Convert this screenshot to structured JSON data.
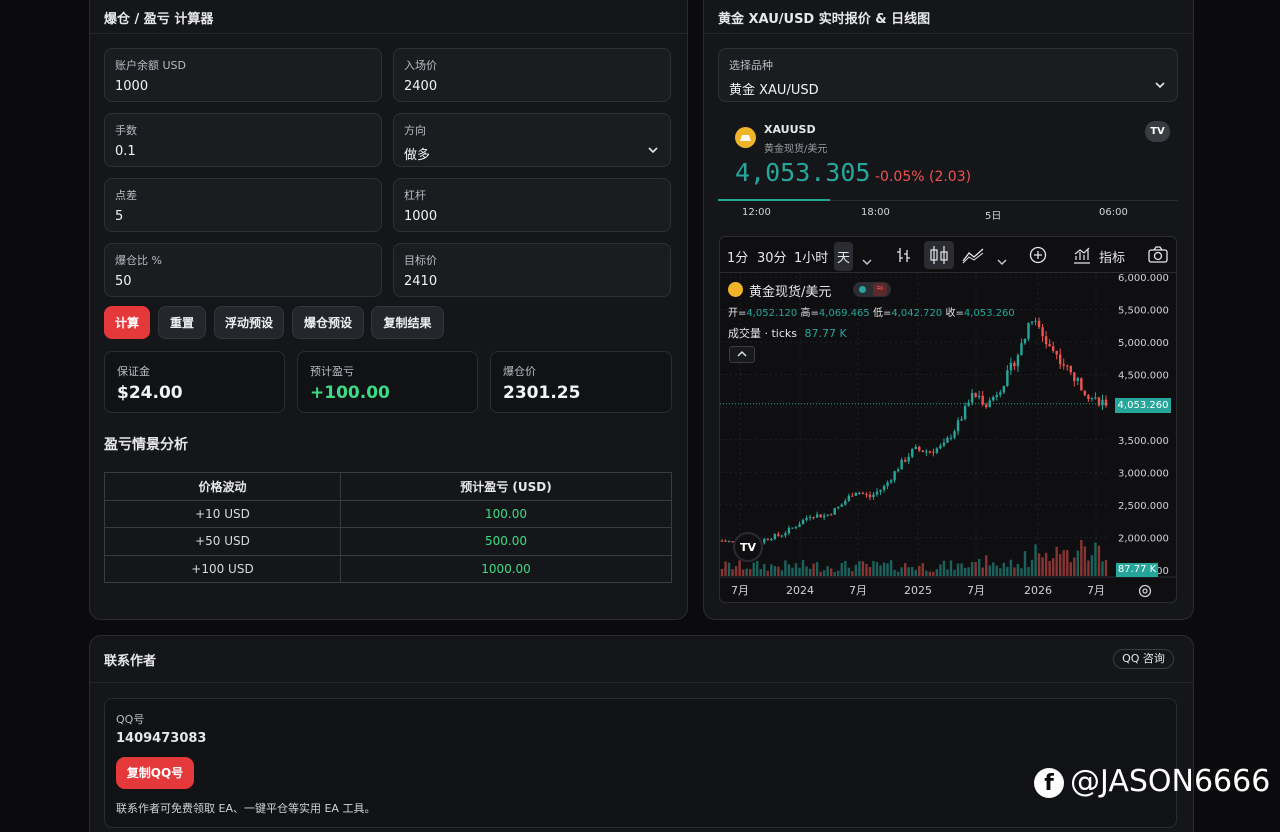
{
  "calc": {
    "title": "爆仓 / 盈亏 计算器",
    "fields": [
      {
        "label": "账户余额 USD",
        "value": "1000"
      },
      {
        "label": "入场价",
        "value": "2400"
      },
      {
        "label": "手数",
        "value": "0.1"
      },
      {
        "label": "方向",
        "value": "做多"
      },
      {
        "label": "点差",
        "value": "5"
      },
      {
        "label": "杠杆",
        "value": "1000"
      },
      {
        "label": "爆仓比 %",
        "value": "50"
      },
      {
        "label": "目标价",
        "value": "2410"
      }
    ],
    "buttons": {
      "calc": "计算",
      "reset": "重置",
      "float": "浮动预设",
      "liq": "爆仓预设",
      "copy": "复制结果"
    },
    "stats": [
      {
        "label": "保证金",
        "value": "$24.00"
      },
      {
        "label": "预计盈亏",
        "value": "+100.00"
      },
      {
        "label": "爆仓价",
        "value": "2301.25"
      }
    ],
    "scenario_title": "盈亏情景分析",
    "scenario_headers": [
      "价格波动",
      "预计盈亏 (USD)"
    ],
    "scenario_rows": [
      [
        "+10 USD",
        "100.00"
      ],
      [
        "+50 USD",
        "500.00"
      ],
      [
        "+100 USD",
        "1000.00"
      ]
    ]
  },
  "quote": {
    "title": "黄金 XAU/USD 实时报价 & 日线图",
    "select_label": "选择品种",
    "select_value": "黄金 XAU/USD",
    "symbol": "XAUUSD",
    "symbol_desc": "黄金现货/美元",
    "price": "4,053.305",
    "change": "-0.05% (2.03)",
    "mini_times": [
      "12:00",
      "18:00",
      "5日",
      "06:00"
    ],
    "tv_logo": "TV"
  },
  "widget": {
    "toolbar": [
      "1分",
      "30分",
      "1小时",
      "天",
      "指标"
    ],
    "legend_title": "黄金现货/美元",
    "ohlc": {
      "o_lbl": "开=",
      "o": "4,052.120",
      "h_lbl": "高=",
      "h": "4,069.465",
      "l_lbl": "低=",
      "l": "4,042.720",
      "c_lbl": "收=",
      "c": "4,053.260"
    },
    "volume_label": "成交量 · ticks",
    "volume_value": "87.77 K",
    "price_badge": "4,053.260",
    "vol_badge": "87.77 K",
    "colors": {
      "up": "#26a69a",
      "down": "#ef5350",
      "accent": "#e5383b",
      "positive": "#3ddc84"
    }
  },
  "chart_data": {
    "type": "candlestick",
    "y_ticks": [
      "6,000.000",
      "5,500.000",
      "5,000.000",
      "4,500.000",
      "4,000.000",
      "3,500.000",
      "3,000.000",
      "2,500.000",
      "2,000.000",
      "1,500.000"
    ],
    "x_ticks": [
      "7月",
      "2024",
      "7月",
      "2025",
      "7月",
      "2026",
      "7月"
    ],
    "ylim": [
      1500,
      6000
    ],
    "close_path": [
      [
        "2023-07",
        1950
      ],
      [
        "2023-09",
        1920
      ],
      [
        "2023-10",
        1850
      ],
      [
        "2023-11",
        1990
      ],
      [
        "2024-01",
        2040
      ],
      [
        "2024-03",
        2180
      ],
      [
        "2024-04",
        2350
      ],
      [
        "2024-06",
        2330
      ],
      [
        "2024-08",
        2480
      ],
      [
        "2024-10",
        2720
      ],
      [
        "2024-11",
        2620
      ],
      [
        "2025-01",
        2780
      ],
      [
        "2025-03",
        3100
      ],
      [
        "2025-04",
        3350
      ],
      [
        "2025-06",
        3320
      ],
      [
        "2025-08",
        3400
      ],
      [
        "2025-09",
        3750
      ],
      [
        "2025-10",
        4200
      ],
      [
        "2025-11",
        4050
      ],
      [
        "2025-12",
        4350
      ],
      [
        "2026-01",
        4800
      ],
      [
        "2026-02",
        5350
      ],
      [
        "2026-03",
        5000
      ],
      [
        "2026-04",
        4700
      ],
      [
        "2026-05",
        4400
      ],
      [
        "2026-06",
        4150
      ],
      [
        "2026-07",
        4053
      ]
    ],
    "last_price": 4053.26,
    "last_volume": "87.77 K"
  },
  "contact": {
    "title": "联系作者",
    "qq_btn": "QQ 咨询",
    "qq_label": "QQ号",
    "qq_number": "1409473083",
    "copy_btn": "复制QQ号",
    "note": "联系作者可免费领取 EA、一键平仓等实用 EA 工具。"
  },
  "watermark": "@JASON6666"
}
